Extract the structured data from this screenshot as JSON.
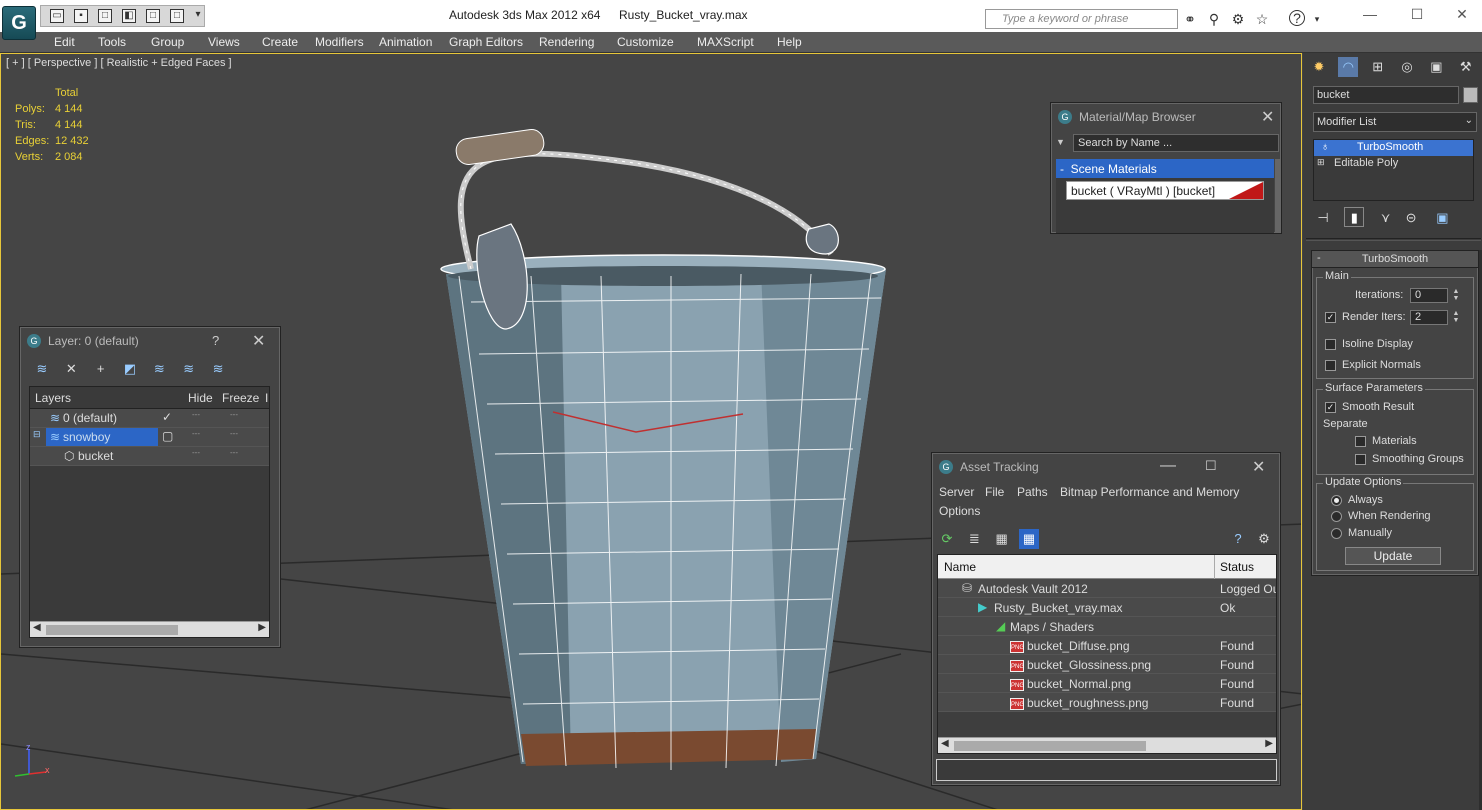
{
  "app": {
    "title": "Autodesk 3ds Max  2012 x64",
    "file": "Rusty_Bucket_vray.max",
    "search_placeholder": "Type a keyword or phrase",
    "logo": "G"
  },
  "menus": [
    "Edit",
    "Tools",
    "Group",
    "Views",
    "Create",
    "Modifiers",
    "Animation",
    "Graph Editors",
    "Rendering",
    "Customize",
    "MAXScript",
    "Help"
  ],
  "viewport": {
    "label": "[ + ] [ Perspective ] [ Realistic + Edged Faces ]",
    "stats_header": "Total",
    "stats": [
      {
        "name": "Polys:",
        "value": "4 144"
      },
      {
        "name": "Tris:",
        "value": "4 144"
      },
      {
        "name": "Edges:",
        "value": "12 432"
      },
      {
        "name": "Verts:",
        "value": "2 084"
      }
    ],
    "axes": {
      "z": "z",
      "x": "x"
    }
  },
  "layer_window": {
    "title": "Layer: 0 (default)",
    "help": "?",
    "columns": [
      "Layers",
      "Hide",
      "Freeze",
      "I"
    ],
    "rows": [
      {
        "name": "0 (default)",
        "active": "✓",
        "hide": "---",
        "freeze": "---"
      },
      {
        "name": "snowboy",
        "active": "▢",
        "hide": "---",
        "freeze": "---"
      },
      {
        "name": "bucket",
        "active": "",
        "hide": "---",
        "freeze": "---"
      }
    ]
  },
  "material_browser": {
    "title": "Material/Map Browser",
    "search_placeholder": "Search by Name ...",
    "section": "Scene Materials",
    "item": "bucket  ( VRayMtl ) [bucket]",
    "item_swatch_color": "#c01818"
  },
  "asset_tracking": {
    "title": "Asset Tracking",
    "menus": [
      "Server",
      "File",
      "Paths",
      "Bitmap Performance and Memory",
      "Options"
    ],
    "columns": [
      "Name",
      "Status"
    ],
    "rows": [
      {
        "name": "Autodesk Vault 2012",
        "status": "Logged Ou"
      },
      {
        "name": "Rusty_Bucket_vray.max",
        "status": "Ok"
      },
      {
        "name": "Maps / Shaders",
        "status": ""
      },
      {
        "name": "bucket_Diffuse.png",
        "status": "Found"
      },
      {
        "name": "bucket_Glossiness.png",
        "status": "Found"
      },
      {
        "name": "bucket_Normal.png",
        "status": "Found"
      },
      {
        "name": "bucket_roughness.png",
        "status": "Found"
      }
    ],
    "png_badge": "PNG"
  },
  "command_panel": {
    "object_name": "bucket",
    "modifier_list": "Modifier List",
    "stack": [
      "TurboSmooth",
      "Editable Poly"
    ],
    "rollout_title": "TurboSmooth",
    "rollout_toggle": "-",
    "main_group": "Main",
    "iterations_label": "Iterations:",
    "iterations_value": "0",
    "render_iters_label": "Render Iters:",
    "render_iters_value": "2",
    "isoline_label": "Isoline Display",
    "explicit_normals_label": "Explicit Normals",
    "surface_group": "Surface Parameters",
    "smooth_result_label": "Smooth Result",
    "separate_label": "Separate",
    "materials_label": "Materials",
    "smoothing_groups_label": "Smoothing Groups",
    "update_group": "Update Options",
    "always_label": "Always",
    "when_rendering_label": "When Rendering",
    "manually_label": "Manually",
    "update_button": "Update"
  }
}
